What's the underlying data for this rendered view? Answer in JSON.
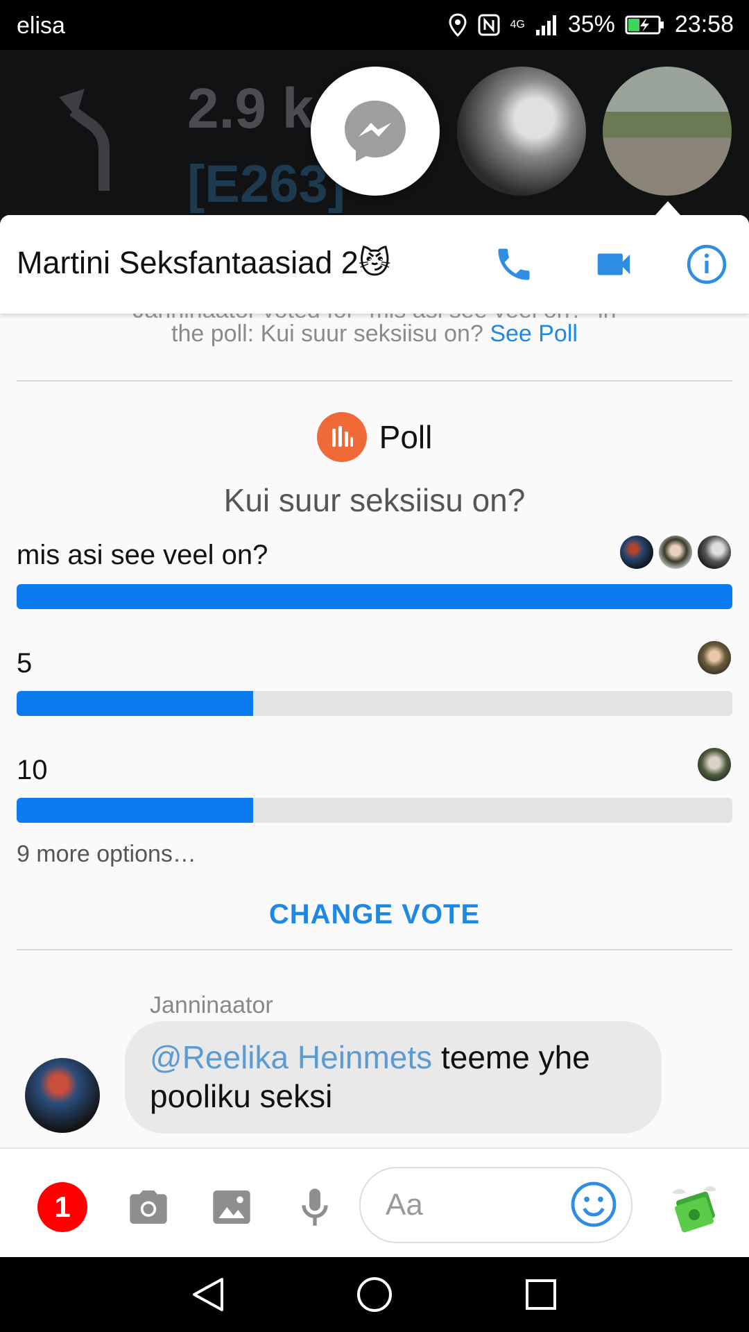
{
  "status_bar": {
    "carrier": "elisa",
    "network": "4G",
    "battery": "35%",
    "time": "23:58"
  },
  "navigation": {
    "distance": "2.9 k",
    "road": "[E263]"
  },
  "chat": {
    "title": "Martini Seksfantaasiad 2😼"
  },
  "system_message": {
    "line1": "Janninaator voted for \"mis asi see veel on?\" in",
    "line2": "the poll: Kui suur seksiisu on?",
    "link": "See Poll"
  },
  "poll": {
    "label": "Poll",
    "question": "Kui suur seksiisu on?",
    "options": [
      {
        "label": "mis asi see veel on?",
        "fill": 1.0,
        "votes": 3
      },
      {
        "label": "5",
        "fill": 0.33,
        "votes": 1
      },
      {
        "label": "10",
        "fill": 0.33,
        "votes": 1
      }
    ],
    "more": "9 more options…",
    "change_vote": "CHANGE VOTE"
  },
  "message": {
    "sender": "Janninaator",
    "mention": "@Reelika Heinmets",
    "text": " teeme yhe pooliku seksi"
  },
  "composer": {
    "badge_count": "1",
    "placeholder": "Aa"
  },
  "icons": [
    "turn-left-icon",
    "messenger-icon",
    "phone-icon",
    "video-icon",
    "info-icon",
    "poll-icon",
    "camera-icon",
    "gallery-icon",
    "mic-icon",
    "emoji-icon",
    "money-icon",
    "back-icon",
    "home-icon",
    "recents-icon"
  ],
  "colors": {
    "accent": "#0a7cf0",
    "link": "#1e88e5",
    "poll_icon": "#f06a37",
    "badge": "#ff0000"
  }
}
